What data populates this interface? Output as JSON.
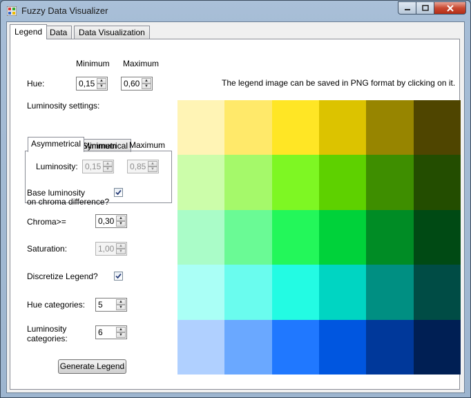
{
  "window": {
    "title": "Fuzzy Data Visualizer",
    "controls": {
      "minimize": "–",
      "maximize": "□",
      "close": "✕"
    }
  },
  "tabs": [
    {
      "label": "Legend",
      "active": true
    },
    {
      "label": "Data",
      "active": false
    },
    {
      "label": "Data Visualization",
      "active": false
    }
  ],
  "hue": {
    "label": "Hue:",
    "min_header": "Minimum",
    "max_header": "Maximum",
    "min": "0,15",
    "max": "0,60"
  },
  "info_text": "The legend image can be saved in PNG format by clicking on it.",
  "luminosity_settings": {
    "label": "Luminosity settings:",
    "tabs": [
      {
        "label": "Asymmetrical",
        "active": true
      },
      {
        "label": "Symmetrical",
        "active": false
      }
    ],
    "min_header": "Minimum",
    "max_header": "Maximum",
    "luminosity_label": "Luminosity:",
    "min": "0,15",
    "max": "0,85",
    "enabled": false
  },
  "base_luminosity": {
    "label_line1": "Base luminosity",
    "label_line2": "on chroma difference?",
    "checked": true
  },
  "chroma": {
    "label": "Chroma>=",
    "value": "0,30"
  },
  "saturation": {
    "label": "Saturation:",
    "value": "1,00",
    "enabled": false
  },
  "discretize": {
    "label": "Discretize Legend?",
    "checked": true
  },
  "hue_categories": {
    "label": "Hue categories:",
    "value": "5"
  },
  "luminosity_categories": {
    "label_line1": "Luminosity",
    "label_line2": "categories:",
    "value": "6"
  },
  "generate_button": "Generate Legend",
  "legend_colors": [
    [
      "#fff4b5",
      "#ffe96a",
      "#ffe625",
      "#dcc300",
      "#978500",
      "#4f4500"
    ],
    [
      "#ccfdaa",
      "#a5f96a",
      "#7ef723",
      "#5ed100",
      "#3e8e00",
      "#234d00"
    ],
    [
      "#aafcc8",
      "#6afa95",
      "#23f75a",
      "#00d23a",
      "#008c25",
      "#004a14"
    ],
    [
      "#aafff6",
      "#6afcee",
      "#23fbe3",
      "#00d5c2",
      "#008f82",
      "#004c45"
    ],
    [
      "#b0d0ff",
      "#6aa8ff",
      "#2078ff",
      "#0056e0",
      "#00389a",
      "#001f54"
    ]
  ]
}
